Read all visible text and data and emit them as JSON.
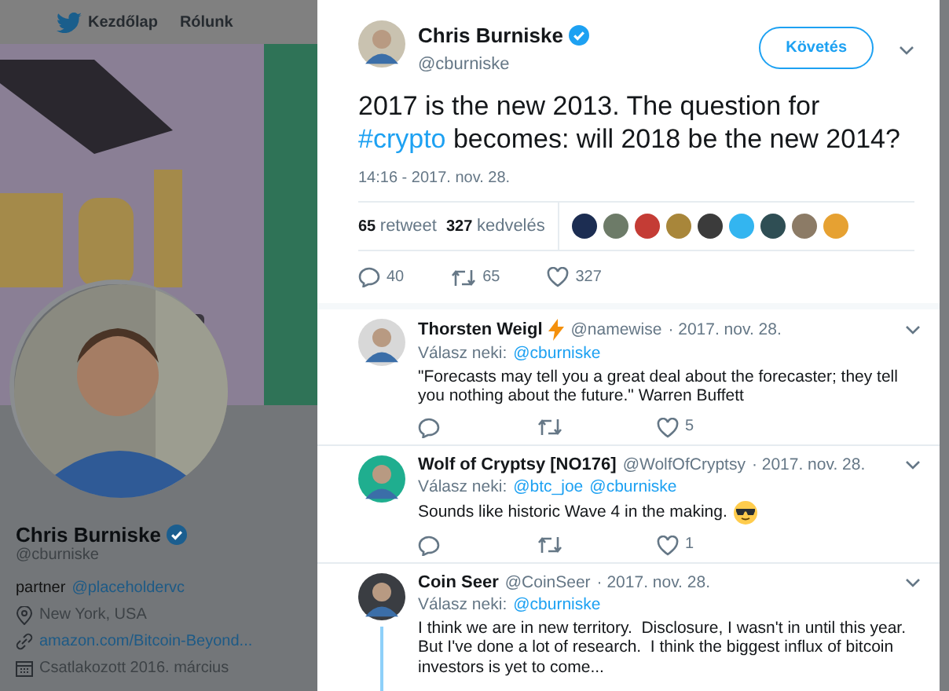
{
  "background_page": {
    "nav": [
      {
        "label": "Kezdőlap"
      },
      {
        "label": "Rólunk"
      }
    ],
    "profile": {
      "name": "Chris Burniske",
      "verified": true,
      "handle": "@cburniske",
      "bio": "partner",
      "bio_mention": "@placeholdervc",
      "location": "New York, USA",
      "website": "amazon.com/Bitcoin-Beyond...",
      "joined": "Csatlakozott 2016. március"
    }
  },
  "tweet": {
    "author": {
      "name": "Chris Burniske",
      "verified": true,
      "handle": "@cburniske"
    },
    "follow_button": "Követés",
    "text_before": "2017 is the new 2013. The question for",
    "hashtag": "#crypto",
    "text_after": "becomes: will 2018 be the new 2014?",
    "time": "14:16 - 2017. nov. 28.",
    "stats": [
      {
        "count": "65",
        "label": "retweet"
      },
      {
        "count": "327",
        "label": "kedvelés"
      }
    ],
    "likers": [
      {
        "color": "#1c2d52"
      },
      {
        "color": "#6d7b68"
      },
      {
        "color": "#c43c35"
      },
      {
        "color": "#a8863a"
      },
      {
        "color": "#3b3b3b"
      },
      {
        "color": "#33b5f0"
      },
      {
        "color": "#2f4e54"
      },
      {
        "color": "#8c7b66"
      },
      {
        "color": "#e6a132"
      }
    ],
    "actions": {
      "reply": "40",
      "retweet": "65",
      "like": "327"
    }
  },
  "replies": [
    {
      "name": "Thorsten Weigl",
      "lightning_badge": true,
      "handle": "@namewise",
      "date": "· 2017. nov. 28.",
      "reply_to_label": "Válasz neki:",
      "mentions": [
        "@cburniske"
      ],
      "text": "\"Forecasts may tell you a great deal about the forecaster; they tell you nothing about the future.\" Warren Buffett",
      "actions": {
        "like": "5"
      },
      "thread_line": false
    },
    {
      "name": "Wolf of Cryptsy [NO176]",
      "handle": "@WolfOfCryptsy",
      "date": "· 2017. nov. 28.",
      "reply_to_label": "Válasz neki:",
      "mentions": [
        "@btc_joe",
        "@cburniske"
      ],
      "text": "Sounds like historic Wave 4 in the making.",
      "sunglasses_emoji": true,
      "actions": {
        "like": "1"
      },
      "thread_line": false
    },
    {
      "name": "Coin Seer",
      "handle": "@CoinSeer",
      "date": "· 2017. nov. 28.",
      "reply_to_label": "Válasz neki:",
      "mentions": [
        "@cburniske"
      ],
      "text": "I think we are in new territory.  Disclosure, I wasn't in until this year.  But I've done a lot of research.  I think the biggest influx of bitcoin investors is yet to come...",
      "thread_line": true
    }
  ]
}
